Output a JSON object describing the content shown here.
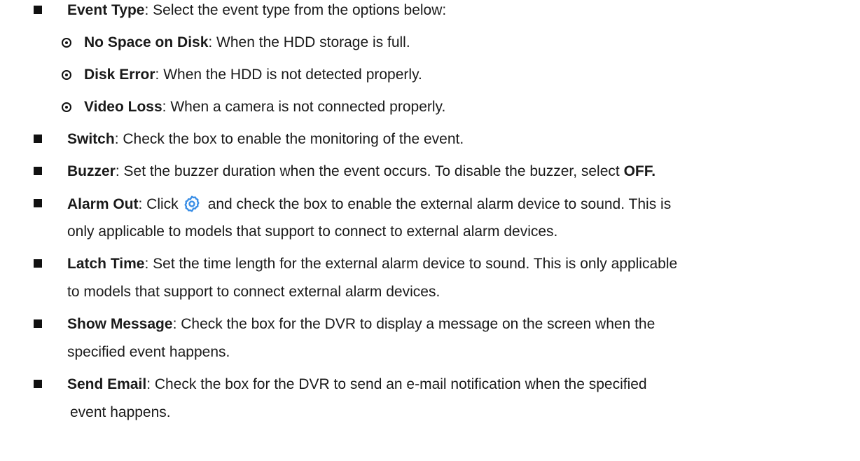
{
  "items": [
    {
      "term": "Event Type",
      "text": ": Select the event type from the options below:"
    },
    {
      "term": "No Space on Disk",
      "text": ": When the HDD storage is full."
    },
    {
      "term": "Disk Error",
      "text": ": When the HDD is not detected properly."
    },
    {
      "term": "Video Loss",
      "text": ": When a camera is not connected properly."
    },
    {
      "term": "Switch",
      "text": ": Check the box to enable the monitoring of the event."
    },
    {
      "term": "Buzzer",
      "text": ": Set the buzzer duration when the event occurs. To disable the buzzer, select ",
      "term2": "OFF."
    },
    {
      "term": "Alarm Out",
      "text_pre": ": Click",
      "text_post": "and check the box to enable the external alarm device to sound. This is",
      "text_line2": "only applicable to models that support to connect to external alarm devices."
    },
    {
      "term": "Latch Time",
      "text": ": Set the time length for the external alarm device to sound. This is only applicable",
      "text_line2": "to models that support to connect external alarm devices."
    },
    {
      "term": "Show Message",
      "text": ": Check the box for the DVR to display a message on the screen when the",
      "text_line2": "specified event happens."
    },
    {
      "term": "Send Email",
      "text": ": Check the box for the DVR to send an e-mail notification when the specified",
      "text_line2": "event happens."
    }
  ],
  "icons": {
    "settings_gear": "gear-icon",
    "gear_color": "#3a8ee6"
  }
}
